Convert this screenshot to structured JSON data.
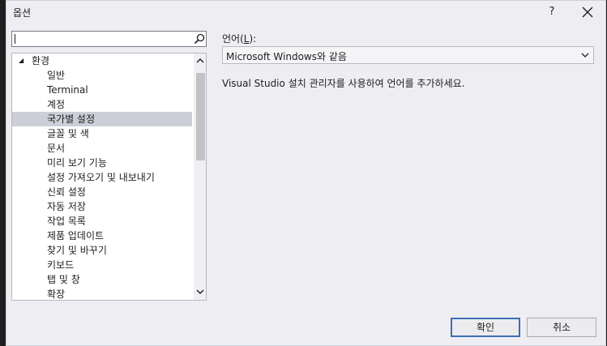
{
  "dialog": {
    "title": "옵션",
    "help_label": "?"
  },
  "search": {
    "value": "",
    "placeholder": ""
  },
  "tree": {
    "root": {
      "label": "환경",
      "expanded": true
    },
    "items": [
      {
        "label": "일반"
      },
      {
        "label": "Terminal"
      },
      {
        "label": "계정"
      },
      {
        "label": "국가별 설정",
        "selected": true
      },
      {
        "label": "글꼴 및 색"
      },
      {
        "label": "문서"
      },
      {
        "label": "미리 보기 기능"
      },
      {
        "label": "설정 가져오기 및 내보내기"
      },
      {
        "label": "신뢰 설정"
      },
      {
        "label": "자동 저장"
      },
      {
        "label": "작업 목록"
      },
      {
        "label": "제품 업데이트"
      },
      {
        "label": "찾기 및 바꾸기"
      },
      {
        "label": "키보드"
      },
      {
        "label": "탭 및 창"
      },
      {
        "label": "확장"
      }
    ]
  },
  "language": {
    "label_prefix": "언어(",
    "label_mnemonic": "L",
    "label_suffix": "):",
    "selected": "Microsoft Windows와 같음"
  },
  "info_text": "Visual Studio 설치 관리자를 사용하여 언어를 추가하세요.",
  "buttons": {
    "ok": "확인",
    "cancel": "취소"
  },
  "colors": {
    "selection": "#ccced8",
    "dialog_background": "#eeeef2",
    "default_button_border": "#3b6fb6"
  }
}
